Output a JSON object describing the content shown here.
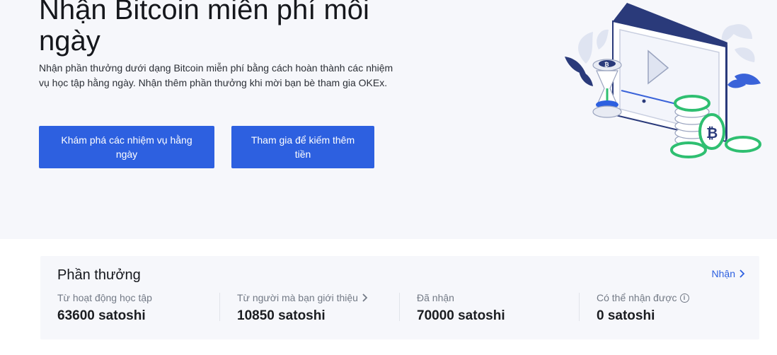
{
  "hero": {
    "title": "Nhận Bitcoin miễn phí mỗi ngày",
    "description": "Nhận phần thưởng dưới dạng Bitcoin miễn phí bằng cách hoàn thành các nhiệm vụ học tập hằng ngày. Nhận thêm phần thưởng khi mời bạn bè tham gia OKEx.",
    "explore_button": "Khám phá các nhiệm vụ hằng ngày",
    "join_button": "Tham gia để kiếm thêm tiền"
  },
  "colors": {
    "accent": "#2d60e0",
    "hero_bg": "#f6f7fb",
    "coin_green": "#2fbf71"
  },
  "rewards": {
    "title": "Phần thưởng",
    "claim_link": "Nhận",
    "stats": [
      {
        "label": "Từ hoạt động học tập",
        "value": "63600 satoshi"
      },
      {
        "label": "Từ người mà bạn giới thiệu",
        "value": "10850 satoshi"
      },
      {
        "label": "Đã nhận",
        "value": "70000 satoshi"
      },
      {
        "label": "Có thể nhận được",
        "value": "0 satoshi"
      }
    ]
  }
}
